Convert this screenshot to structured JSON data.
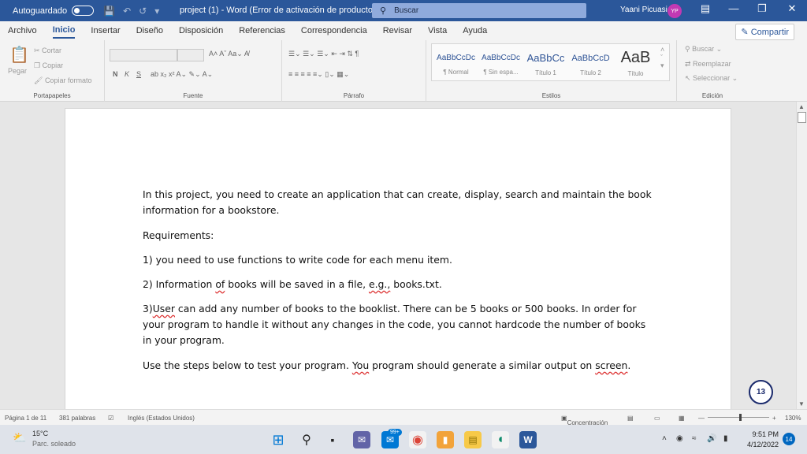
{
  "titlebar": {
    "autosave": "Autoguardado",
    "doc_title": "project (1)  -  Word (Error de activación de productos)",
    "search": "Buscar",
    "user": "Yaani Picuasi",
    "avatar": "YP"
  },
  "menu": {
    "tabs": [
      "Archivo",
      "Inicio",
      "Insertar",
      "Diseño",
      "Disposición",
      "Referencias",
      "Correspondencia",
      "Revisar",
      "Vista",
      "Ayuda"
    ],
    "share": "Compartir"
  },
  "ribbon": {
    "clipboard": {
      "paste": "Pegar",
      "cut": "Cortar",
      "copy": "Copiar",
      "format_painter": "Copiar formato",
      "label": "Portapapeles"
    },
    "font": {
      "label": "Fuente",
      "bold": "N",
      "italic": "K",
      "underline": "S"
    },
    "paragraph": {
      "label": "Párrafo"
    },
    "styles": {
      "label": "Estilos",
      "items": [
        {
          "sample": "AaBbCcDc",
          "name": "¶ Normal"
        },
        {
          "sample": "AaBbCcDc",
          "name": "¶ Sin espa..."
        },
        {
          "sample": "AaBbCc",
          "name": "Título 1"
        },
        {
          "sample": "AaBbCcD",
          "name": "Título 2"
        },
        {
          "sample": "AaB",
          "name": "Título"
        }
      ]
    },
    "editing": {
      "label": "Edición",
      "find": "Buscar",
      "replace": "Reemplazar",
      "select": "Seleccionar"
    }
  },
  "document": {
    "p1": "In this project, you need to create an application that can create, display, search and maintain the book information for a bookstore.",
    "p2": "Requirements:",
    "p3": "1) you need to use functions to write code for each menu item.",
    "p4a": "2) Information ",
    "p4b": "of",
    "p4c": " books will be saved in a file, ",
    "p4d": "e.g.,",
    "p4e": " books.txt.",
    "p5a": "3)",
    "p5b": "User",
    "p5c": " can add any number of books to the booklist. There can be 5 books or 500 books. In order for your program to handle it without any changes in the code, you cannot hardcode the number of books in your program.",
    "p6a": "Use the steps below to test your program. ",
    "p6b": "You",
    "p6c": " program should generate a similar output on ",
    "p6d": "screen",
    "p6e": ".",
    "badge": "13"
  },
  "status": {
    "page": "Página 1 de 11",
    "words": "381 palabras",
    "language": "Inglés (Estados Unidos)",
    "focus": "Concentración",
    "zoom": "130%"
  },
  "taskbar": {
    "temp": "15°C",
    "weather": "Parc. soleado",
    "mail_badge": "99+",
    "time": "9:51 PM",
    "date": "4/12/2022",
    "notifications": "14"
  }
}
